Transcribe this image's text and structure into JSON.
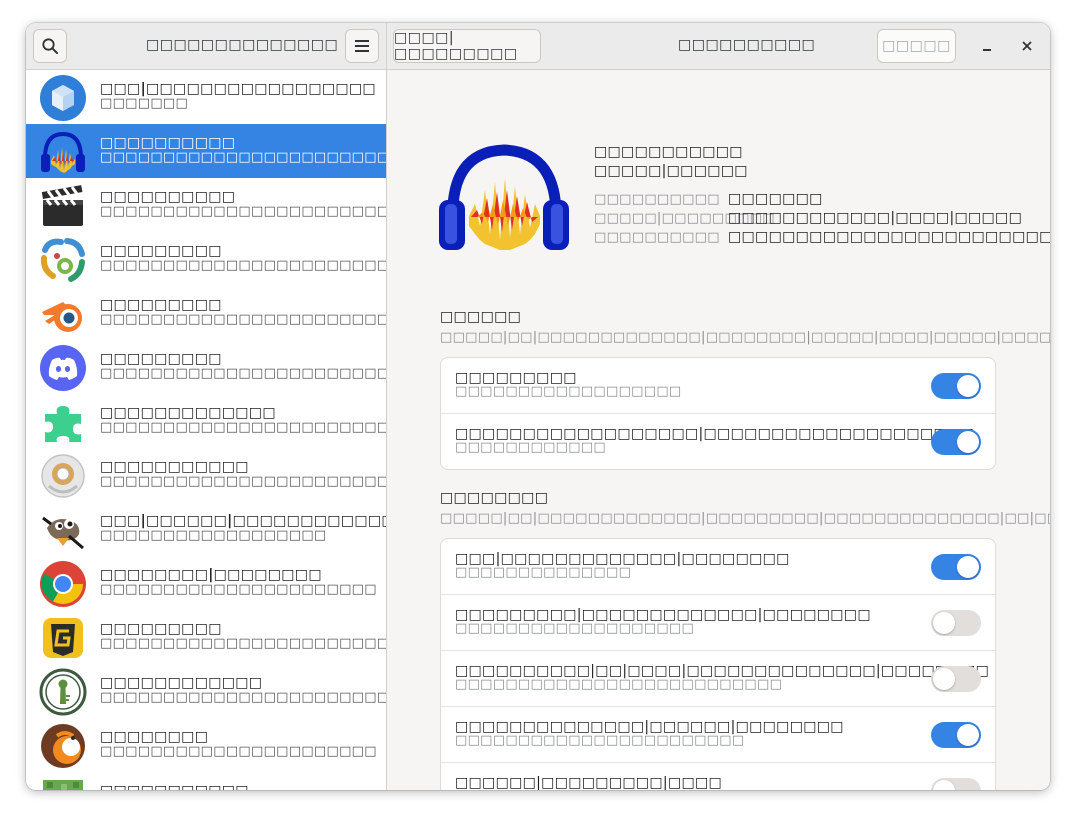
{
  "header": {
    "sidebar_title": "□□□□□□□□□□□□□□",
    "search_icon": "search-icon",
    "menu_icon": "hamburger-menu-icon",
    "open_settings_label": "□□□□|□□□□□□□□□",
    "main_title": "□□□□□□□□□□",
    "reset_label": "□□□□□",
    "minimize_icon": "minimize-icon",
    "close_icon": "close-icon"
  },
  "sidebar": {
    "apps": [
      {
        "name": "□□□|□□□□□□□□□□□□□□□□□",
        "desc": "□□□□□□□",
        "icon": "blue-cube-app-icon"
      },
      {
        "name": "□□□□□□□□□□",
        "desc": "□□□□□□□□□□□□□□□□□□□□□□□□□□□□□□□□□",
        "icon": "headphones-waveform-app-icon"
      },
      {
        "name": "□□□□□□□□□□",
        "desc": "□□□□□□□□□□□□□□□□□□□□□□□□□□□",
        "icon": "clapperboard-app-icon"
      },
      {
        "name": "□□□□□□□□□",
        "desc": "□□□□□□□□□□□□□□□□□□□□□□□□□□□□□□□□□□□",
        "icon": "colored-arcs-app-icon"
      },
      {
        "name": "□□□□□□□□□",
        "desc": "□□□□□□□□□□□□□□□□□□□□□□□□□",
        "icon": "blender-app-icon"
      },
      {
        "name": "□□□□□□□□□",
        "desc": "□□□□□□□□□□□□□□□□□□□□□□□□□□□",
        "icon": "discord-app-icon"
      },
      {
        "name": "□□□□□□□□□□□□□",
        "desc": "□□□□□□□□□□□□□□□□□□□□□□□□□□",
        "icon": "puzzle-piece-app-icon"
      },
      {
        "name": "□□□□□□□□□□□",
        "desc": "□□□□□□□□□□□□□□□□□□□□□□□□□□□□□□□□□",
        "icon": "tape-roll-app-icon"
      },
      {
        "name": "□□□|□□□□□□|□□□□□□□□□□□□□□□□□□□|□□□□□□□□",
        "desc": "□□□□□□□□□□□□□□□□□□",
        "icon": "gimp-app-icon"
      },
      {
        "name": "□□□□□□□□|□□□□□□□□",
        "desc": "□□□□□□□□□□□□□□□□□□□□□□",
        "icon": "chrome-app-icon"
      },
      {
        "name": "□□□□□□□□□",
        "desc": "□□□□□□□□□□□□□□□□□□□□□□□□",
        "icon": "gold-g-app-icon"
      },
      {
        "name": "□□□□□□□□□□□□",
        "desc": "□□□□□□□□□□□□□□□□□□□□□□□□□□□□□□□",
        "icon": "keyhole-app-icon"
      },
      {
        "name": "□□□□□□□□",
        "desc": "□□□□□□□□□□□□□□□□□□□□□□",
        "icon": "orange-bird-app-icon"
      },
      {
        "name": "□□□□□□□□□□□",
        "desc": "",
        "icon": "grass-block-app-icon"
      }
    ]
  },
  "main": {
    "app_name": "□□□□□□□□□□□",
    "app_subtitle": "□□□□□|□□□□□□",
    "details": [
      {
        "label": "□□□□□□□□□□",
        "value": "□□□□□□□"
      },
      {
        "label": "□□□□□|□□□□□□□□□",
        "value": "□□□□□□□□□□□□|□□□□|□□□□□"
      },
      {
        "label": "□□□□□□□□□□",
        "value": "□□□□□□□□□□□□□□□□□□□□□□□□□□□□□□□□□□□"
      }
    ],
    "sections": [
      {
        "title": "□□□□□□",
        "desc": "□□□□□|□□|□□□□□□□□□□□□□|□□□□□□□□|□□□□□|□□□□|□□□□□|□□□□□□□□",
        "rows": [
          {
            "title": "□□□□□□□□□",
            "sub": "□□□□□□□□□□□□□□□□□□",
            "on": true
          },
          {
            "title": "□□□□□□□□□□□□□□□□□□|□□□□□□□□□□□□□□□□□□□□",
            "sub": "□□□□□□□□□□□□",
            "on": true
          }
        ]
      },
      {
        "title": "□□□□□□□□",
        "desc": "□□□□□|□□|□□□□□□□□□□□□□|□□□□□□□□□|□□□□□□□□□□□□□□|□□|□□□□|□□□□□□□□□□",
        "rows": [
          {
            "title": "□□□|□□□□□□□□□□□□□|□□□□□□□□",
            "sub": "□□□□□□□□□□□□□□",
            "on": true
          },
          {
            "title": "□□□□□□□□□|□□□□□□□□□□□□□|□□□□□□□□",
            "sub": "□□□□□□□□□□□□□□□□□□□",
            "on": false
          },
          {
            "title": "□□□□□□□□□□|□□|□□□□|□□□□□□□□□□□□□□|□□□□□□□□",
            "sub": "□□□□□□□□□□□□□□□□□□□□□□□□□□",
            "on": false
          },
          {
            "title": "□□□□□□□□□□□□□□|□□□□□□|□□□□□□□□",
            "sub": "□□□□□□□□□□□□□□□□□□□□□□□",
            "on": true
          },
          {
            "title": "□□□□□□|□□□□□□□□□|□□□□",
            "sub": "□□□□□□□□□□□□□□□□□□□□□□□□□□□□",
            "on": false
          }
        ]
      }
    ]
  }
}
